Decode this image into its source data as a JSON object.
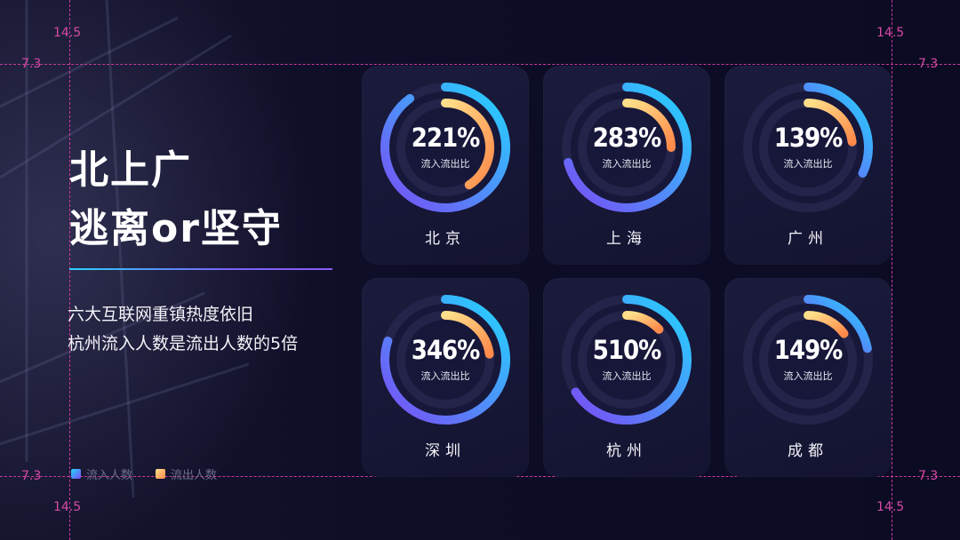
{
  "guides": {
    "top_left_value": "14.5",
    "top_right_value": "14.5",
    "bottom_left_value": "14.5",
    "bottom_right_value": "14.5",
    "left_top_value": "7.3",
    "right_top_value": "7.3",
    "left_bottom_value": "7.3",
    "right_bottom_value": "7.3",
    "color": "#c93a9a"
  },
  "headline": {
    "line1": "北上广",
    "line2": "逃离or坚守"
  },
  "subtitle": {
    "line1": "六大互联网重镇热度依旧",
    "line2": "杭州流入人数是流出人数的5倍"
  },
  "legend": [
    {
      "label": "流入人数",
      "color": "#3d8bff"
    },
    {
      "label": "流出人数",
      "color": "#ffb45a"
    }
  ],
  "colors": {
    "inflow_start": "#22d6ff",
    "inflow_end": "#7a4cf5",
    "outflow_start": "#ffe08a",
    "outflow_end": "#ff8a4a",
    "track": "#24244a"
  },
  "chart_data": {
    "type": "donut",
    "value_label": "流入流出比",
    "cities": [
      {
        "name": "北京",
        "ratio_label": "221%",
        "ratio": 2.21,
        "inflow_fraction": 0.9,
        "outflow_fraction": 0.41
      },
      {
        "name": "上海",
        "ratio_label": "283%",
        "ratio": 2.83,
        "inflow_fraction": 0.71,
        "outflow_fraction": 0.25
      },
      {
        "name": "广州",
        "ratio_label": "139%",
        "ratio": 1.39,
        "inflow_fraction": 0.32,
        "outflow_fraction": 0.23
      },
      {
        "name": "深圳",
        "ratio_label": "346%",
        "ratio": 3.46,
        "inflow_fraction": 0.8,
        "outflow_fraction": 0.23
      },
      {
        "name": "杭州",
        "ratio_label": "510%",
        "ratio": 5.1,
        "inflow_fraction": 0.66,
        "outflow_fraction": 0.13
      },
      {
        "name": "成都",
        "ratio_label": "149%",
        "ratio": 1.49,
        "inflow_fraction": 0.22,
        "outflow_fraction": 0.15
      }
    ]
  }
}
